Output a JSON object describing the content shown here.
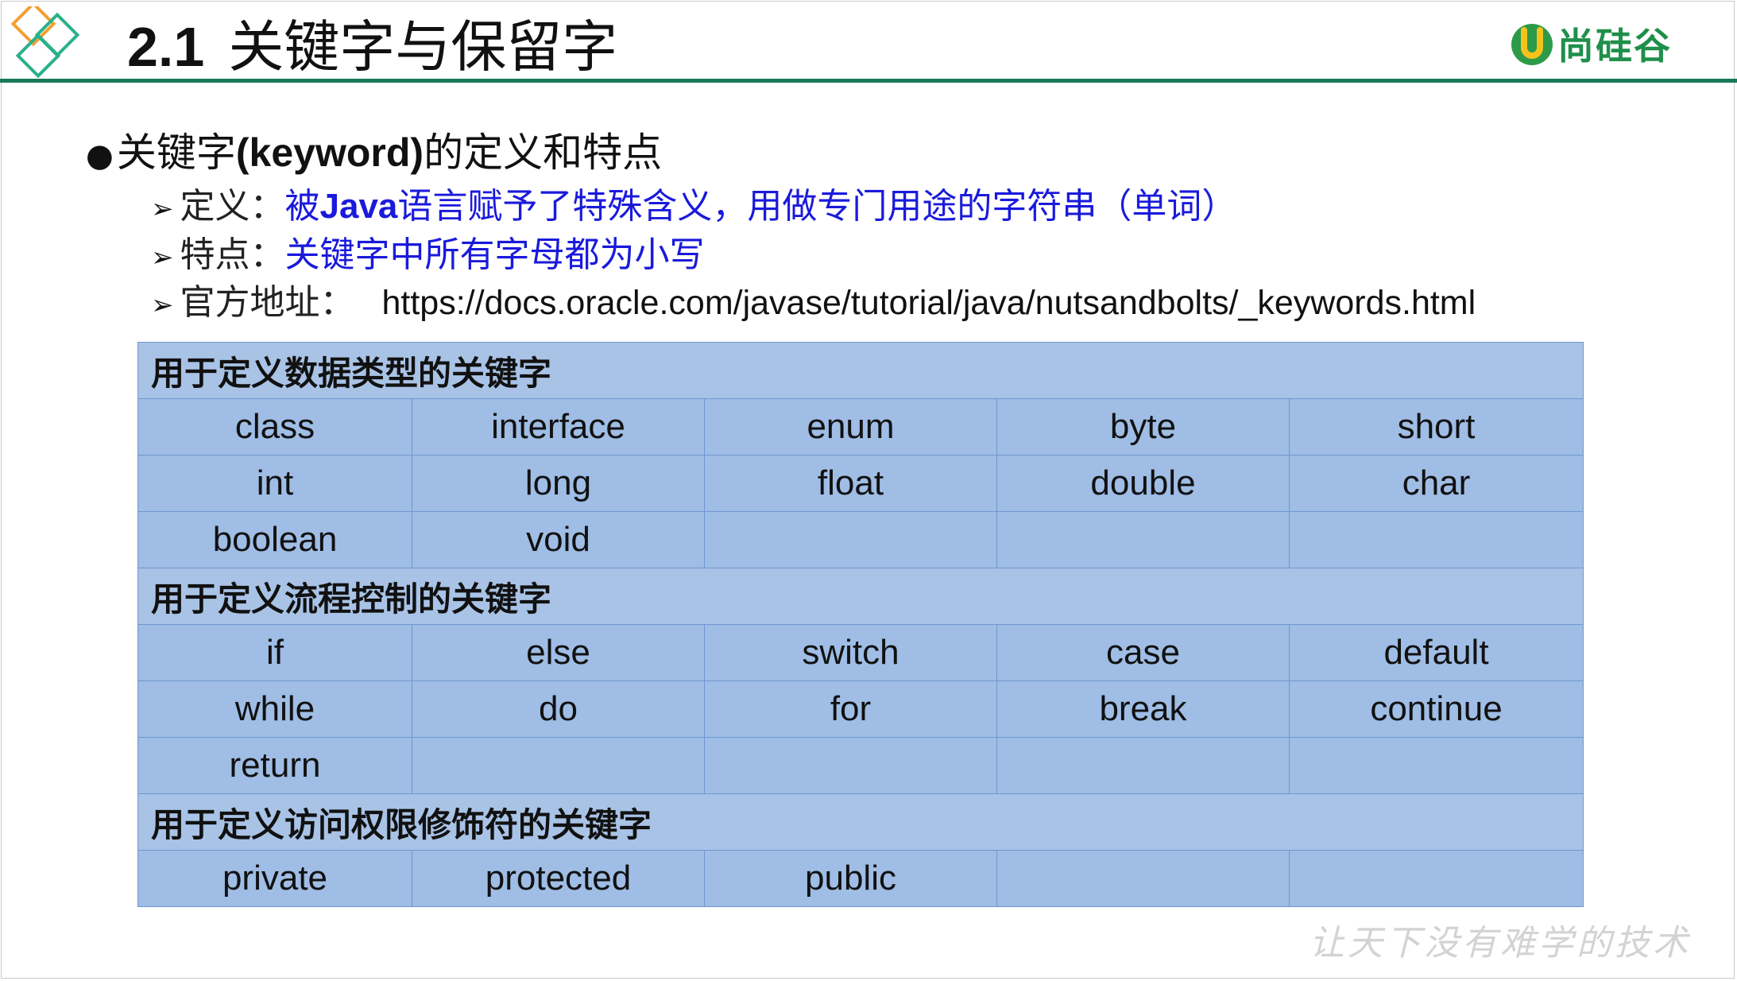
{
  "header": {
    "section_number": "2.1",
    "title": "关键字与保留字",
    "brand_name": "尚硅谷",
    "accent_color": "#1a7a5a"
  },
  "main": {
    "heading_prefix": "关键字",
    "heading_keyword": "(keyword)",
    "heading_suffix": "的定义和特点",
    "items": [
      {
        "label": "定义：",
        "value_pre": "被",
        "value_bold": "Java",
        "value_post": "语言赋予了特殊含义，用做专门用途的字符串（单词）"
      },
      {
        "label": "特点：",
        "value": "关键字中所有字母都为小写"
      },
      {
        "label": "官方地址：",
        "url": "https://docs.oracle.com/javase/tutorial/java/nutsandbolts/_keywords.html"
      }
    ]
  },
  "table": {
    "sections": [
      {
        "title": "用于定义数据类型的关键字",
        "rows": [
          [
            "class",
            "interface",
            "enum",
            "byte",
            "short"
          ],
          [
            "int",
            "long",
            "float",
            "double",
            "char"
          ],
          [
            "boolean",
            "void",
            "",
            "",
            ""
          ]
        ]
      },
      {
        "title": "用于定义流程控制的关键字",
        "rows": [
          [
            "if",
            "else",
            "switch",
            "case",
            "default"
          ],
          [
            "while",
            "do",
            "for",
            "break",
            "continue"
          ],
          [
            "return",
            "",
            "",
            "",
            ""
          ]
        ]
      },
      {
        "title": "用于定义访问权限修饰符的关键字",
        "rows": [
          [
            "private",
            "protected",
            "public",
            "",
            ""
          ]
        ]
      }
    ],
    "header_color": "#a8c3e6",
    "row_color": "#9fbde5"
  },
  "footer": {
    "slogan": "让天下没有难学的技术"
  }
}
